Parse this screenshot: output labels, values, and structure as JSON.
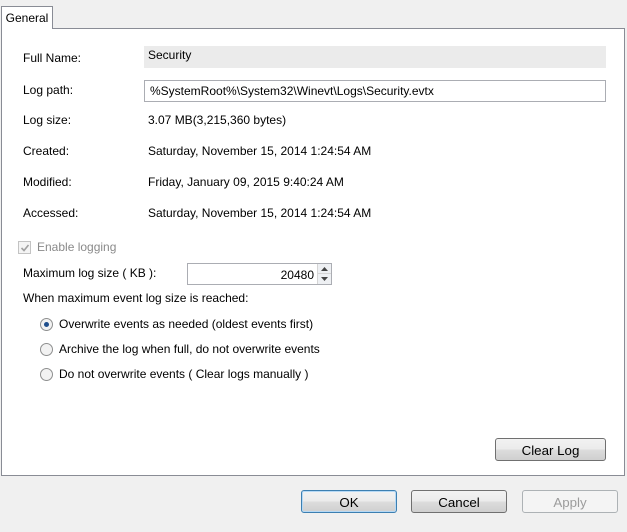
{
  "tabs": [
    "General"
  ],
  "fields": {
    "full_name": {
      "label": "Full Name:",
      "value": "Security"
    },
    "log_path": {
      "label": "Log path:",
      "value": "%SystemRoot%\\System32\\Winevt\\Logs\\Security.evtx"
    },
    "log_size": {
      "label": "Log size:",
      "value": "3.07 MB(3,215,360 bytes)"
    },
    "created": {
      "label": "Created:",
      "value": "Saturday, November 15, 2014 1:24:54 AM"
    },
    "modified": {
      "label": "Modified:",
      "value": "Friday, January 09, 2015 9:40:24 AM"
    },
    "accessed": {
      "label": "Accessed:",
      "value": "Saturday, November 15, 2014 1:24:54 AM"
    }
  },
  "enable_logging": {
    "label": "Enable logging",
    "checked": true,
    "disabled": true
  },
  "max_size": {
    "label": "Maximum log size ( KB ):",
    "value": "20480"
  },
  "policy": {
    "heading": "When maximum event log size is reached:",
    "options": [
      {
        "label": "Overwrite events as needed (oldest events first)",
        "selected": true
      },
      {
        "label": "Archive the log when full, do not overwrite events",
        "selected": false
      },
      {
        "label": "Do not overwrite events ( Clear logs manually )",
        "selected": false
      }
    ]
  },
  "buttons": {
    "clear_log": "Clear Log",
    "ok": "OK",
    "cancel": "Cancel",
    "apply": "Apply"
  }
}
